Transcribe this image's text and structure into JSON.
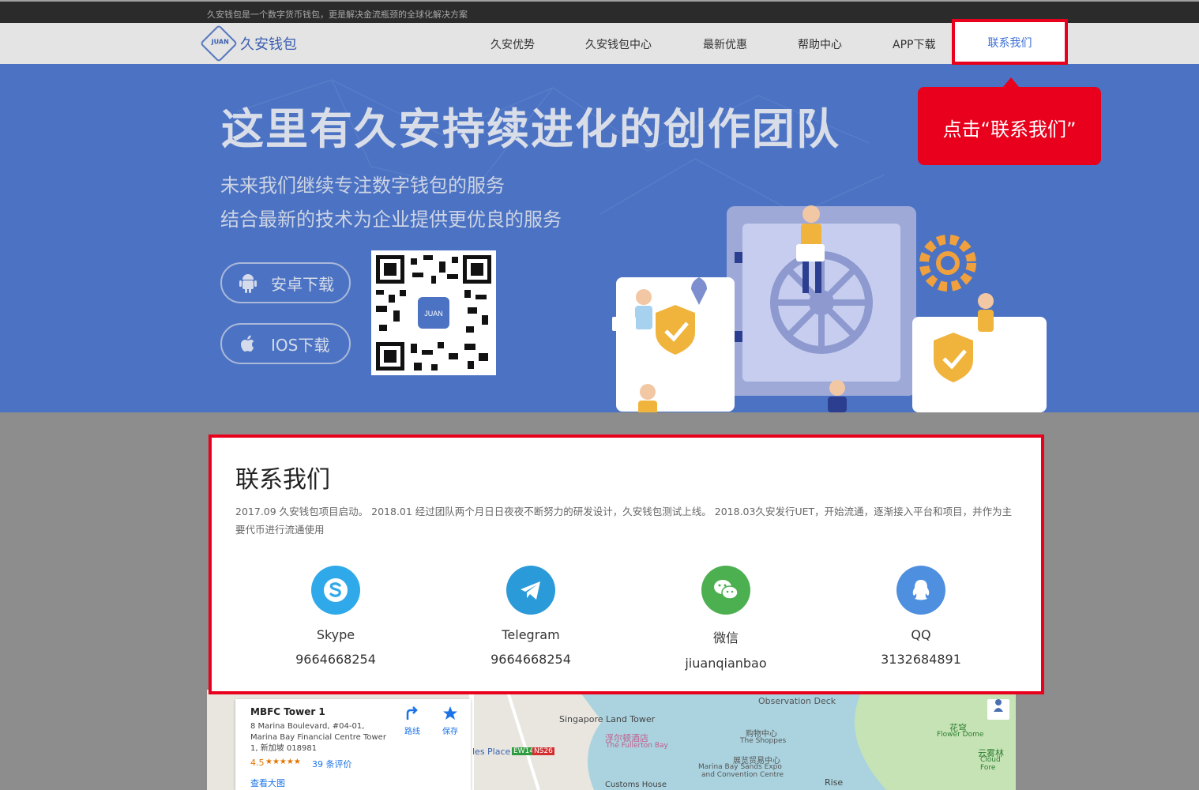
{
  "topbar": {
    "tagline": "久安钱包是一个数字货币钱包，更是解决金流瓶颈的全球化解决方案"
  },
  "header": {
    "logo_mark": "JUAN",
    "logo_name": "久安钱包",
    "nav": [
      {
        "label": "久安优势"
      },
      {
        "label": "久安钱包中心"
      },
      {
        "label": "最新优惠"
      },
      {
        "label": "帮助中心"
      },
      {
        "label": "APP下载"
      },
      {
        "label": "联系我们"
      }
    ]
  },
  "hero": {
    "title": "这里有久安持续进化的创作团队",
    "line1": "未来我们继续专注数字钱包的服务",
    "line2": "结合最新的技术为企业提供更优良的服务",
    "android_button": "安卓下载",
    "ios_button": "IOS下载",
    "qr_logo": "JUAN"
  },
  "callout": {
    "text": "点击“联系我们”"
  },
  "contact": {
    "title": "联系我们",
    "description": "2017.09 久安钱包项目启动。 2018.01 经过团队两个月日日夜夜不断努力的研发设计，久安钱包测试上线。 2018.03久安发行UET，开始流通，逐渐接入平台和项目，并作为主要代币进行流通使用",
    "channels": [
      {
        "name": "Skype",
        "value": "9664668254",
        "icon": "skype-icon",
        "color": "#2fa9ea"
      },
      {
        "name": "Telegram",
        "value": "9664668254",
        "icon": "telegram-icon",
        "color": "#2a9ad8"
      },
      {
        "name": "微信",
        "value": "jiuanqianbao",
        "icon": "wechat-icon",
        "color": "#4caf50"
      },
      {
        "name": "QQ",
        "value": "3132684891",
        "icon": "qq-icon",
        "color": "#4e8fe0"
      }
    ]
  },
  "map": {
    "place_name": "MBFC Tower 1",
    "address": "8 Marina Boulevard, #04-01, Marina Bay Financial Centre Tower 1, 新加坡 018981",
    "rating": "4.5",
    "stars": "★★★★★",
    "reviews": "39 条评价",
    "directions": "路线",
    "save": "保存",
    "view_larger": "查看大图",
    "labels": [
      "Observation Deck",
      "Singapore Land Tower",
      "浮尔顿酒店",
      "The Fullerton Bay",
      "购物中心",
      "The Shoppes",
      "花穹",
      "Flower Dome",
      "云雾林",
      "Cloud Fore",
      "les Place",
      "EW14",
      "NS26",
      "展览贸易中心",
      "Marina Bay Sands Expo",
      "and Convention Centre",
      "Customs House",
      "Rise"
    ]
  }
}
